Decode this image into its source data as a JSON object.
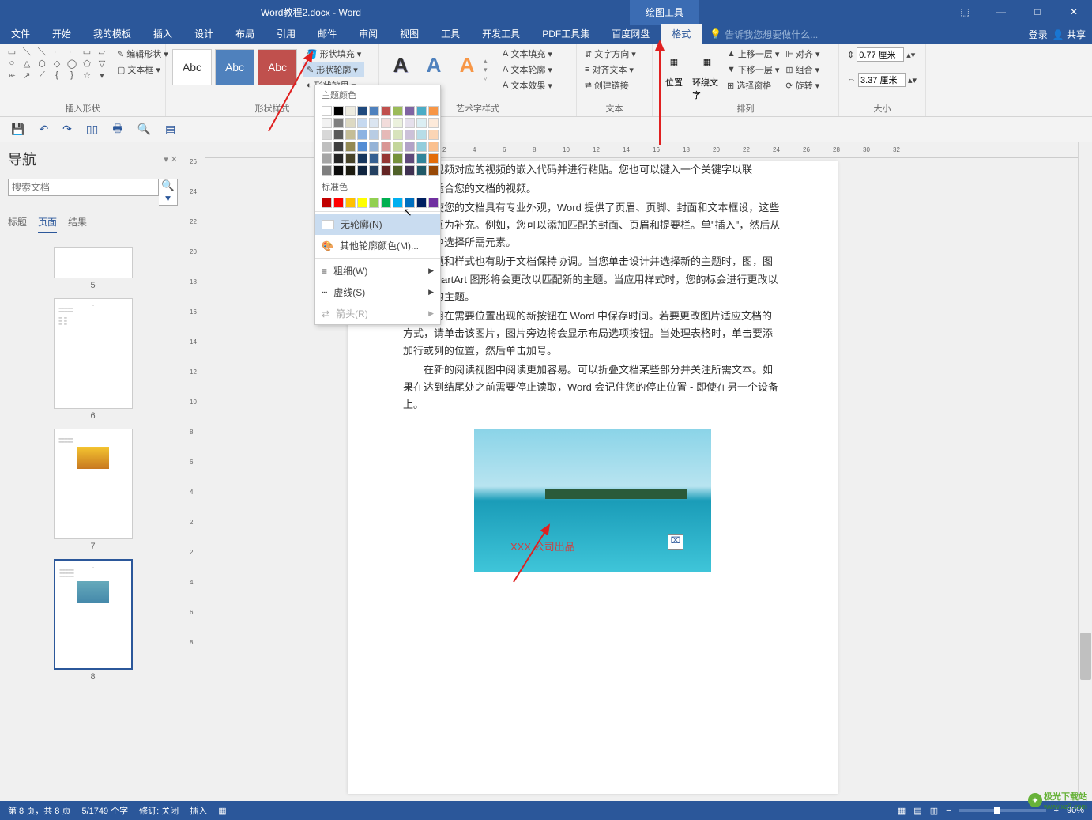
{
  "title": {
    "filename": "Word教程2.docx - Word",
    "context_tool": "绘图工具"
  },
  "window_controls": {
    "ribbon_opts": "⬚",
    "min": "—",
    "max": "□",
    "close": "✕"
  },
  "tabs": [
    "文件",
    "开始",
    "我的模板",
    "插入",
    "设计",
    "布局",
    "引用",
    "邮件",
    "审阅",
    "视图",
    "工具",
    "开发工具",
    "PDF工具集",
    "百度网盘",
    "格式"
  ],
  "tell_me": "告诉我您想要做什么...",
  "top_right": {
    "login": "登录",
    "share": "共享"
  },
  "ribbon": {
    "shapes_group": "插入形状",
    "edit_shape": "编辑形状",
    "text_box": "文本框",
    "style_group": "形状样式",
    "shape_fill": "形状填充",
    "shape_outline": "形状轮廓",
    "shape_effects": "形状效果",
    "wordart_group": "艺术字样式",
    "text_fill": "文本填充",
    "text_outline": "文本轮廓",
    "text_effects": "文本效果",
    "text_group": "文本",
    "text_direction": "文字方向",
    "align_text": "对齐文本",
    "create_link": "创建链接",
    "position": "位置",
    "wrap_text": "环绕文字",
    "arrange_group": "排列",
    "bring_forward": "上移一层",
    "send_backward": "下移一层",
    "selection_pane": "选择窗格",
    "align": "对齐",
    "group_btn": "组合",
    "rotate": "旋转",
    "size_group": "大小",
    "height": "0.77 厘米",
    "width": "3.37 厘米"
  },
  "dropdown": {
    "theme_colors": "主题颜色",
    "standard_colors": "标准色",
    "no_outline": "无轮廓(N)",
    "more_colors": "其他轮廓颜色(M)...",
    "weight": "粗细(W)",
    "dashes": "虚线(S)",
    "arrows": "箭头(R)",
    "theme_palette": [
      [
        "#ffffff",
        "#000000",
        "#eeece1",
        "#1f497d",
        "#4f81bd",
        "#c0504d",
        "#9bbb59",
        "#8064a2",
        "#4bacc6",
        "#f79646"
      ],
      [
        "#f2f2f2",
        "#7f7f7f",
        "#ddd9c3",
        "#c6d9f0",
        "#dbe5f1",
        "#f2dcdb",
        "#ebf1dd",
        "#e5e0ec",
        "#dbeef3",
        "#fdeada"
      ],
      [
        "#d8d8d8",
        "#595959",
        "#c4bd97",
        "#8db3e2",
        "#b8cce4",
        "#e5b9b7",
        "#d7e3bc",
        "#ccc1d9",
        "#b7dde8",
        "#fbd5b5"
      ],
      [
        "#bfbfbf",
        "#3f3f3f",
        "#938953",
        "#548dd4",
        "#95b3d7",
        "#d99694",
        "#c3d69b",
        "#b2a2c7",
        "#92cddc",
        "#fac08f"
      ],
      [
        "#a5a5a5",
        "#262626",
        "#494429",
        "#17365d",
        "#366092",
        "#953734",
        "#76923c",
        "#5f497a",
        "#31859b",
        "#e36c09"
      ],
      [
        "#7f7f7f",
        "#0c0c0c",
        "#1d1b10",
        "#0f243e",
        "#244061",
        "#632423",
        "#4f6128",
        "#3f3151",
        "#205867",
        "#974806"
      ]
    ],
    "standard_palette": [
      "#c00000",
      "#ff0000",
      "#ffc000",
      "#ffff00",
      "#92d050",
      "#00b050",
      "#00b0f0",
      "#0070c0",
      "#002060",
      "#7030a0"
    ]
  },
  "nav": {
    "title": "导航",
    "search_placeholder": "搜索文档",
    "tabs": {
      "headings": "标题",
      "pages": "页面",
      "results": "结果"
    },
    "pages": [
      "5",
      "6",
      "7",
      "8"
    ]
  },
  "document": {
    "line0": "让这些视频对应的视频的嵌入代码并进行粘贴。您也可以键入一个关键字以联",
    "line1": "搜索最适合您的文档的视频。",
    "p2": "为使您的文档具有专业外观，Word 提供了页眉、页脚、封面和文本框设，这些设计可互为补充。例如，您可以添加匹配的封面、页眉和提要栏。单\"插入\"，然后从不同库中选择所需元素。",
    "p3": "主题和样式也有助于文档保持协调。当您单击设计并选择新的主题时，图，图表或 SmartArt 图形将会更改以匹配新的主题。当应用样式时，您的标会进行更改以匹配新的主题。",
    "p4": "使用在需要位置出现的新按钮在 Word 中保存时间。若要更改图片适应文档的方式，请单击该图片，图片旁边将会显示布局选项按钮。当处理表格时，单击要添加行或列的位置，然后单击加号。",
    "p5": "在新的阅读视图中阅读更加容易。可以折叠文档某些部分并关注所需文本。如果在达到结尾处之前需要停止读取，Word 会记住您的停止位置 - 即使在另一个设备上。",
    "textbox_text": "XXX 公司出品"
  },
  "ruler_h": [
    "2",
    "4",
    "6",
    "8",
    "10",
    "12",
    "14",
    "16",
    "18",
    "20",
    "22",
    "24",
    "26",
    "28",
    "30",
    "32"
  ],
  "ruler_v": [
    "26",
    "24",
    "22",
    "20",
    "18",
    "16",
    "14",
    "12",
    "10",
    "8",
    "6",
    "4",
    "2",
    "2",
    "4",
    "6",
    "8"
  ],
  "status": {
    "page": "第 8 页，共 8 页",
    "words": "5/1749 个字",
    "revision": "修订: 关闭",
    "insert": "插入",
    "zoom": "90%"
  },
  "watermark": {
    "text1": "极光下载站",
    "text2": "www.xz7.com"
  }
}
